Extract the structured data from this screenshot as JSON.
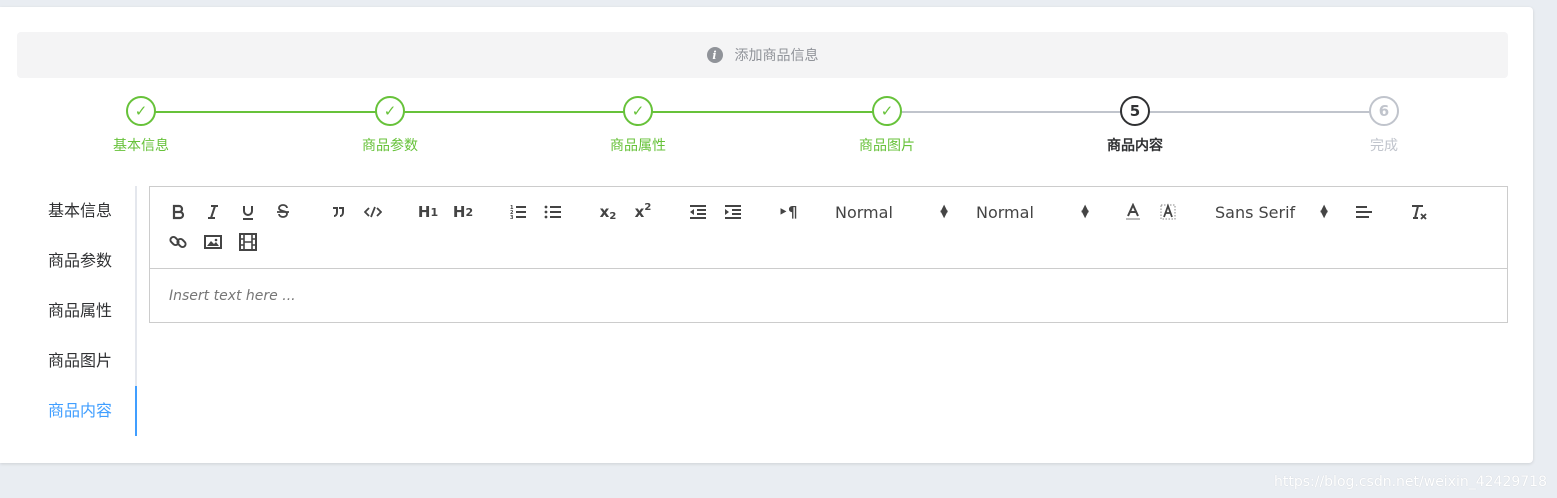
{
  "alert": {
    "text": "添加商品信息",
    "icon": "info-icon"
  },
  "steps": [
    {
      "label": "基本信息",
      "status": "done",
      "marker": "✓"
    },
    {
      "label": "商品参数",
      "status": "done",
      "marker": "✓"
    },
    {
      "label": "商品属性",
      "status": "done",
      "marker": "✓"
    },
    {
      "label": "商品图片",
      "status": "done",
      "marker": "✓"
    },
    {
      "label": "商品内容",
      "status": "process",
      "marker": "5"
    },
    {
      "label": "完成",
      "status": "wait",
      "marker": "6"
    }
  ],
  "tabs": [
    {
      "label": "基本信息"
    },
    {
      "label": "商品参数"
    },
    {
      "label": "商品属性"
    },
    {
      "label": "商品图片"
    },
    {
      "label": "商品内容",
      "active": true
    }
  ],
  "editor": {
    "header_select": "Normal",
    "size_select": "Normal",
    "font_select": "Sans Serif",
    "placeholder": "Insert text here ..."
  },
  "watermark": "https://blog.csdn.net/weixin_42429718",
  "colors": {
    "success": "#67c23a",
    "active_tab": "#409eff",
    "process": "#303133",
    "wait": "#c0c4cc"
  }
}
